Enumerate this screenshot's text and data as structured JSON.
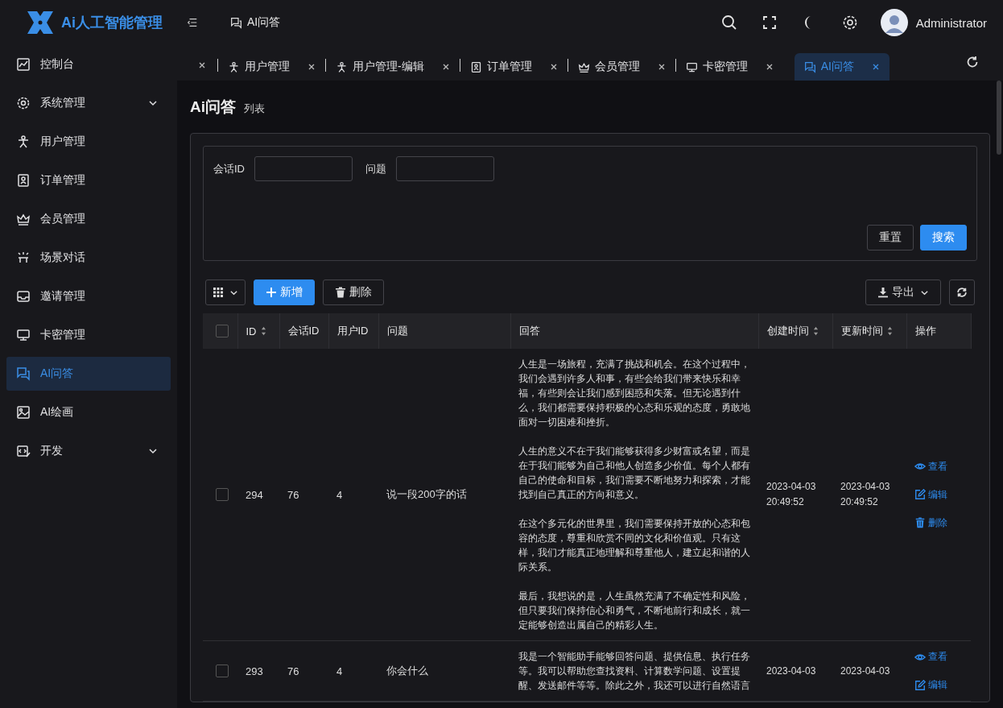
{
  "app": {
    "title": "Ai人工智能管理"
  },
  "header": {
    "breadcrumb": "AI问答",
    "user": "Administrator"
  },
  "sidebar": {
    "items": [
      {
        "label": "控制台",
        "selected": false,
        "expandable": false
      },
      {
        "label": "系统管理",
        "selected": false,
        "expandable": true
      },
      {
        "label": "用户管理",
        "selected": false,
        "expandable": false
      },
      {
        "label": "订单管理",
        "selected": false,
        "expandable": false
      },
      {
        "label": "会员管理",
        "selected": false,
        "expandable": false
      },
      {
        "label": "场景对话",
        "selected": false,
        "expandable": false
      },
      {
        "label": "邀请管理",
        "selected": false,
        "expandable": false
      },
      {
        "label": "卡密管理",
        "selected": false,
        "expandable": false
      },
      {
        "label": "AI问答",
        "selected": true,
        "expandable": false
      },
      {
        "label": "AI绘画",
        "selected": false,
        "expandable": false
      },
      {
        "label": "开发",
        "selected": false,
        "expandable": true
      }
    ]
  },
  "tabs": [
    {
      "label": "用户管理",
      "selected": false
    },
    {
      "label": "用户管理-编辑",
      "selected": false
    },
    {
      "label": "订单管理",
      "selected": false
    },
    {
      "label": "会员管理",
      "selected": false
    },
    {
      "label": "卡密管理",
      "selected": false
    },
    {
      "label": "AI问答",
      "selected": true
    }
  ],
  "page": {
    "title": "Ai问答",
    "subtitle": "列表"
  },
  "filters": [
    {
      "label": "会话ID"
    },
    {
      "label": "问题"
    }
  ],
  "filter_buttons": {
    "reset": "重置",
    "search": "搜索"
  },
  "toolbar": {
    "add": "新增",
    "delete": "删除",
    "export": "导出"
  },
  "table": {
    "select_all": false,
    "columns": [
      {
        "label": "ID",
        "sortable": true
      },
      {
        "label": "会话ID",
        "sortable": false
      },
      {
        "label": "用户ID",
        "sortable": false
      },
      {
        "label": "问题",
        "sortable": false
      },
      {
        "label": "回答",
        "sortable": false
      },
      {
        "label": "创建时间",
        "sortable": true
      },
      {
        "label": "更新时间",
        "sortable": true
      },
      {
        "label": "操作",
        "sortable": false
      }
    ],
    "rows": [
      {
        "selected": false,
        "id": "294",
        "session_id": "76",
        "user_id": "4",
        "question": "说一段200字的话",
        "answer": [
          "人生是一场旅程，充满了挑战和机会。在这个过程中，我们会遇到许多人和事，有些会给我们带来快乐和幸福，有些则会让我们感到困惑和失落。但无论遇到什么，我们都需要保持积极的心态和乐观的态度，勇敢地面对一切困难和挫折。",
          "人生的意义不在于我们能够获得多少财富或名望，而是在于我们能够为自己和他人创造多少价值。每个人都有自己的使命和目标，我们需要不断地努力和探索，才能找到自己真正的方向和意义。",
          "在这个多元化的世界里，我们需要保持开放的心态和包容的态度，尊重和欣赏不同的文化和价值观。只有这样，我们才能真正地理解和尊重他人，建立起和谐的人际关系。",
          "最后，我想说的是，人生虽然充满了不确定性和风险，但只要我们保持信心和勇气，不断地前行和成长，就一定能够创造出属自己的精彩人生。"
        ],
        "created": [
          "2023-04-03",
          "20:49:52"
        ],
        "updated": [
          "2023-04-03",
          "20:49:52"
        ],
        "actions": [
          "查看",
          "编辑",
          "删除"
        ]
      },
      {
        "selected": false,
        "id": "293",
        "session_id": "76",
        "user_id": "4",
        "question": "你会什么",
        "answer": [
          "我是一个智能助手能够回答问题、提供信息、执行任务等。我可以帮助您查找资料、计算数学问题、设置提醒、发送邮件等等。除此之外，我还可以进行自然语言"
        ],
        "created": [
          "2023-04-03"
        ],
        "updated": [
          "2023-04-03"
        ],
        "actions": [
          "查看",
          "编辑"
        ]
      }
    ]
  }
}
